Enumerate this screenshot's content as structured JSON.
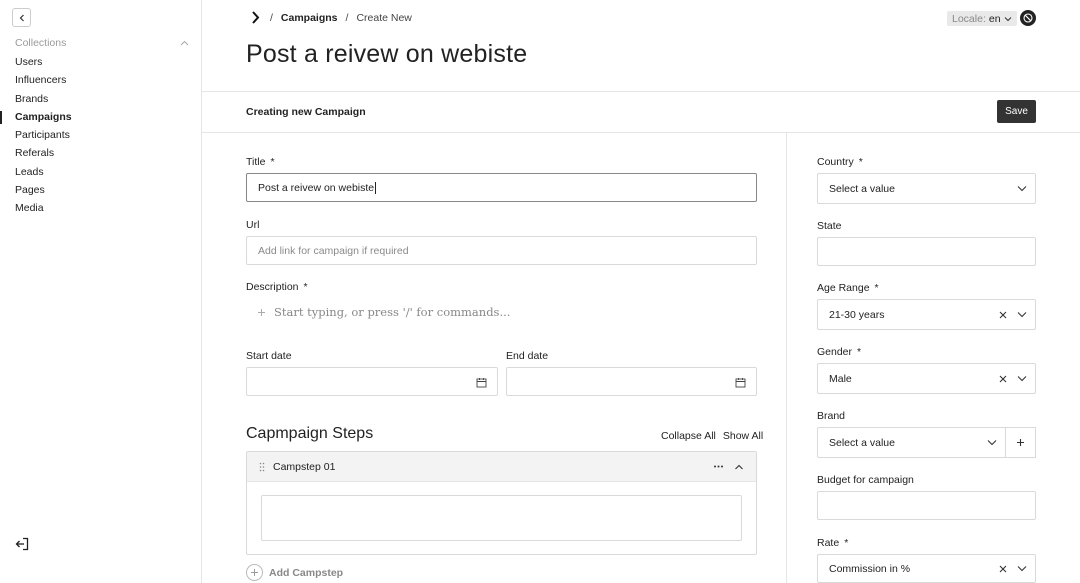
{
  "sidebar": {
    "collections_label": "Collections",
    "items": [
      {
        "label": "Users",
        "active": false
      },
      {
        "label": "Influencers",
        "active": false
      },
      {
        "label": "Brands",
        "active": false
      },
      {
        "label": "Campaigns",
        "active": true
      },
      {
        "label": "Participants",
        "active": false
      },
      {
        "label": "Referals",
        "active": false
      },
      {
        "label": "Leads",
        "active": false
      },
      {
        "label": "Pages",
        "active": false
      },
      {
        "label": "Media",
        "active": false
      }
    ]
  },
  "header": {
    "breadcrumb": {
      "separator": "/",
      "collection": "Campaigns",
      "current": "Create New"
    },
    "locale_label": "Locale:",
    "locale_value": "en"
  },
  "page": {
    "title": "Post a reivew on webiste",
    "edit_label": "Creating new Campaign",
    "save_label": "Save"
  },
  "form": {
    "title": {
      "label": "Title",
      "required_mark": "*",
      "value": "Post a reivew on webiste"
    },
    "url": {
      "label": "Url",
      "placeholder": "Add link for campaign if required"
    },
    "description": {
      "label": "Description",
      "required_mark": "*",
      "placeholder": "Start typing, or press '/' for commands..."
    },
    "start_date": {
      "label": "Start date"
    },
    "end_date": {
      "label": "End date"
    },
    "steps": {
      "title": "Capmpaign Steps",
      "collapse_all": "Collapse All",
      "show_all": "Show All",
      "items": [
        {
          "name": "Campstep 01"
        }
      ],
      "add_label": "Add Campstep"
    }
  },
  "sidebar_form": {
    "country": {
      "label": "Country",
      "required_mark": "*",
      "value": "Select a value"
    },
    "state": {
      "label": "State"
    },
    "age_range": {
      "label": "Age Range",
      "required_mark": "*",
      "value": "21-30 years"
    },
    "gender": {
      "label": "Gender",
      "required_mark": "*",
      "value": "Male"
    },
    "brand": {
      "label": "Brand",
      "value": "Select a value"
    },
    "budget": {
      "label": "Budget for campaign"
    },
    "rate": {
      "label": "Rate",
      "required_mark": "*",
      "value": "Commission in %"
    }
  },
  "icons": {
    "collapse": "chevron-left-icon",
    "collections_toggle": "chevron-up-icon",
    "logout": "logout-icon",
    "logo": "logo-icon",
    "account": "account-icon",
    "calendar": "calendar-icon",
    "drag": "drag-handle-icon",
    "more": "more-horizontal-icon",
    "clear": "close-icon",
    "dropdown": "chevron-down-icon",
    "add": "plus-icon"
  }
}
